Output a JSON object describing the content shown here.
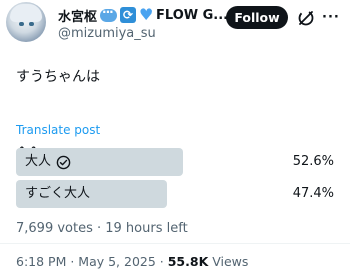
{
  "author": {
    "display_name": "水宮枢",
    "name_suffix": "FLOW G...",
    "handle": "@mizumiya_su",
    "emoji_icons": [
      "speech-bubble-emoji",
      "repeat-emoji",
      "blue-heart-emoji"
    ]
  },
  "actions": {
    "follow_label": "Follow",
    "grok_icon": "grok-icon",
    "more_icon": "more-options-icon"
  },
  "post": {
    "text": "すうちゃんは\n\n^^",
    "translate_label": "Translate post"
  },
  "poll": {
    "options": [
      {
        "label": "大人",
        "percent": 52.6,
        "percent_label": "52.6%",
        "selected": true
      },
      {
        "label": "すごく大人",
        "percent": 47.4,
        "percent_label": "47.4%",
        "selected": false
      }
    ],
    "meta": "7,699 votes · 19 hours left"
  },
  "timestamp": {
    "text": "6:18 PM · May 5, 2025 · ",
    "views_count": "55.8K",
    "views_label": " Views"
  },
  "colors": {
    "accent": "#1d9bf0",
    "poll_bar": "#cfd9de",
    "secondary_text": "#536471",
    "primary_text": "#0f1419"
  }
}
